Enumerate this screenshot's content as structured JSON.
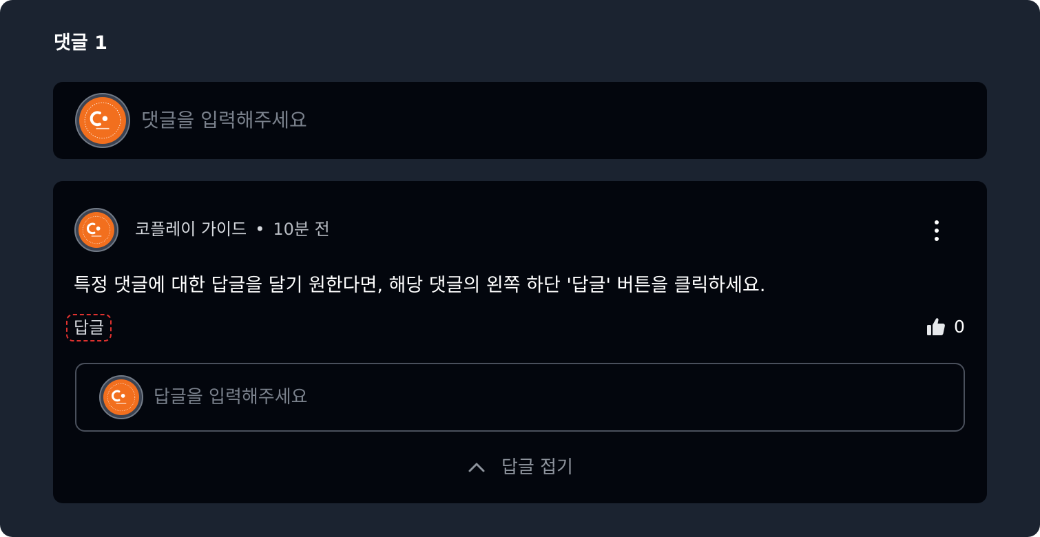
{
  "comments_header": {
    "title": "댓글 1"
  },
  "compose": {
    "placeholder": "댓글을 입력해주세요"
  },
  "comment": {
    "author": "코플레이 가이드",
    "separator": "•",
    "time": "10분 전",
    "body": "특정 댓글에 대한 답글을 달기 원한다면, 해당 댓글의 왼쪽 하단 '답글' 버튼을 클릭하세요.",
    "reply_label": "답글",
    "like_count": "0"
  },
  "reply_compose": {
    "placeholder": "답글을 입력해주세요"
  },
  "collapse": {
    "label": "답글 접기"
  },
  "colors": {
    "panel_bg": "#1b2330",
    "card_bg": "#03060d",
    "avatar_orange": "#f26f1e",
    "highlight_red": "#e0322f"
  },
  "icons": {
    "avatar": "coplay-logo-avatar",
    "more": "more-vertical-icon",
    "like": "thumbs-up-icon",
    "collapse": "chevron-up-icon"
  }
}
